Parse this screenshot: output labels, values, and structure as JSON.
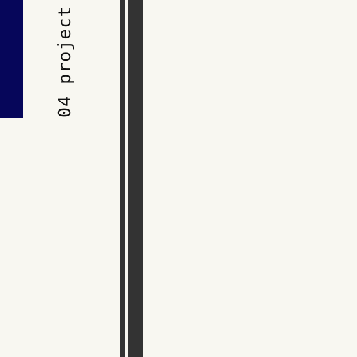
{
  "sidebar": {
    "nav_item": {
      "label": "04 project"
    }
  },
  "colors": {
    "background": "#f8f7f1",
    "accent_block": "#06065a",
    "rules": "#333333",
    "text": "#111111"
  }
}
